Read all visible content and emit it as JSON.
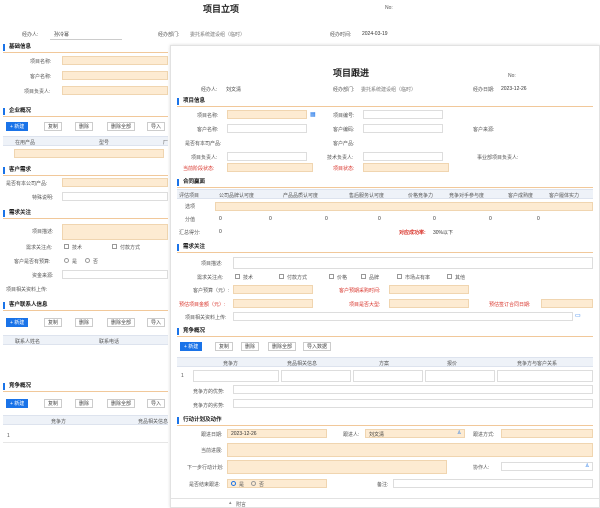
{
  "back": {
    "title": "项目立项",
    "no_label": "No:",
    "handler_label": "经办人:",
    "handler_value": "孙冷幂",
    "dept_label": "经办部门:",
    "dept_value": "委托系统建设组（临时）",
    "time_label": "经办时间:",
    "time_value": "2024-03-19",
    "basic_section": "基础信息",
    "project_name_label": "项目名称:",
    "customer_name_label": "客户名称:",
    "project_owner_label": "项目负责人:",
    "product_section": "企业概况",
    "buttons": [
      "+ 新建",
      "复制",
      "删除",
      "删除全部",
      "导入"
    ],
    "product_cols": [
      "在用产品",
      "型号",
      "厂"
    ],
    "customer_section": "客户需求",
    "existing_label": "是否有本公司产品:",
    "special_label": "特殊说明:",
    "demand_section": "需求关注",
    "project_desc_label": "项目描述:",
    "focus_label": "需求关注点:",
    "focus_options": [
      "技术",
      "付款方式"
    ],
    "budget_label": "客户是否有预算:",
    "budget_options": [
      "是",
      "否"
    ],
    "source_label": "资金来源:",
    "attach_label": "项目相关资料上传:",
    "contact_section": "客户联系人信息",
    "contact_cols": [
      "联系人姓名",
      "联系电话"
    ],
    "compete_section": "竞争概况",
    "compete_cols": [
      "竞争方",
      "竞品相关信息"
    ],
    "compete_row": "1"
  },
  "front": {
    "title": "项目跟进",
    "no_label": "No:",
    "handler_label": "经办人:",
    "handler_value": "刘文清",
    "dept_label": "经办部门:",
    "dept_value": "委托系统建设组（临时）",
    "date_label": "经办日期:",
    "date_value": "2023-12-26",
    "project_section": "项目信息",
    "project_name_label": "项目名称:",
    "project_no_label": "项目编号:",
    "customer_name_label": "客户名称:",
    "customer_no_label": "客户编码:",
    "customer_source_label": "客户来源:",
    "existing_label": "是否有本司产品:",
    "customer_product_label": "客户产品:",
    "project_owner_label": "项目负责人:",
    "tech_owner_label": "技术负责人:",
    "biz_owner_label": "事业部项目负责人:",
    "current_stage_label": "当前阶段状态:",
    "project_status_label": "项目状态:",
    "eval_section": "合同赢面",
    "eval_cols": [
      "评估项目",
      "公司品牌认可度",
      "产品品质认可度",
      "售后服务认可度",
      "价格竞争力",
      "竞争对手参与度",
      "客户成熟度",
      "客户履体实力"
    ],
    "eval_row1": "选项",
    "eval_row2": "分值",
    "eval_scores": [
      "0",
      "0",
      "0",
      "0",
      "0",
      "0",
      "0"
    ],
    "total_label": "汇总得分:",
    "total_value": "0",
    "rate_label": "对应成功率:",
    "rate_value": "30%以下",
    "demand_section": "需求关注",
    "project_desc_label": "项目描述:",
    "focus_label": "需求关注点:",
    "focus_options": [
      "技术",
      "付款方式",
      "价格",
      "品牌",
      "市场占有率",
      "其他"
    ],
    "budget_label": "客户预算（元）:",
    "plan_date_label": "客户预期采购时间:",
    "amount_label": "预估项目金额（元）:",
    "big_project_label": "项目是否大型:",
    "expected_label": "预估签订合同日期:",
    "attach_label": "项目相关资料上传:",
    "compete_section": "竞争概况",
    "buttons": [
      "+ 新建",
      "复制",
      "删除",
      "删除全部",
      "导入数据"
    ],
    "compete_cols": [
      "竞争方",
      "竞品相关信息",
      "方案",
      "报价",
      "竞争方与客户关系"
    ],
    "compete_row": "1",
    "compete_adv_label": "竞争方的优势:",
    "compete_dis_label": "竞争方的劣势:",
    "action_section": "行动计划及动作",
    "follow_date_label": "跟进日期:",
    "follow_date_value": "2023-12-26",
    "follower_label": "跟进人:",
    "follower_value": "刘文清",
    "follow_way_label": "跟进方式:",
    "progress_label": "当前进展:",
    "next_plan_label": "下一步行动计划:",
    "assist_label": "协作人:",
    "ended_label": "是否结束跟进:",
    "ended_options": [
      "是",
      "否"
    ],
    "remark_label": "备注:",
    "footer_label": "附言"
  }
}
